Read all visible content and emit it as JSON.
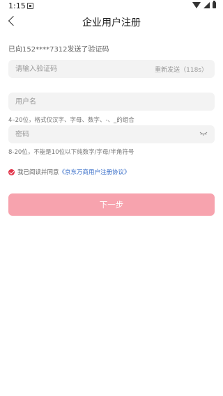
{
  "status_bar": {
    "time": "1:15"
  },
  "header": {
    "title": "企业用户注册"
  },
  "sent_hint": "已向152****7312发送了验证码",
  "code_field": {
    "placeholder": "请输入验证码",
    "resend_label": "重新发送（118s）"
  },
  "username_field": {
    "placeholder": "用户名",
    "help": "4–20位，格式仅汉字、字母、数字、-、_的组合"
  },
  "password_field": {
    "placeholder": "密码",
    "help": "8-20位，不能是10位以下纯数字/字母/半角符号"
  },
  "agreement": {
    "prefix": "我已阅读并同意",
    "link": "《京东万商用户注册协议》"
  },
  "next_button": {
    "label": "下一步"
  },
  "colors": {
    "accent": "#e1354a",
    "button": "#f7a3ae",
    "link": "#3a6fc9"
  }
}
